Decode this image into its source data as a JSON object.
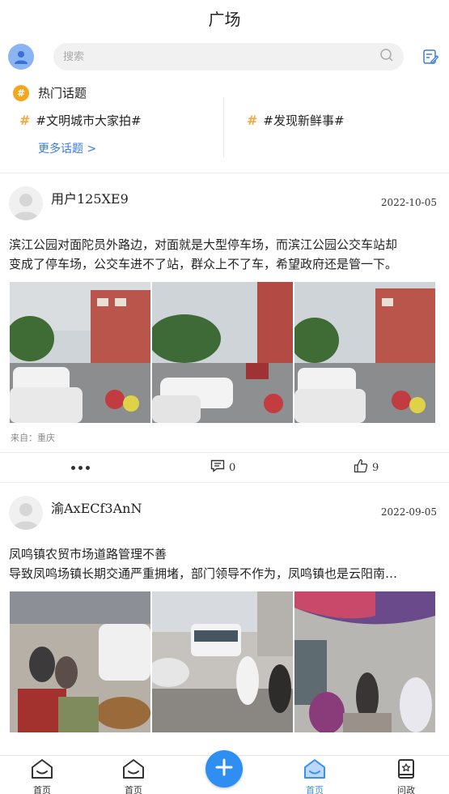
{
  "header": {
    "title": "广场"
  },
  "search": {
    "placeholder": "搜索"
  },
  "topics": {
    "heading": "热门话题",
    "items": [
      "#文明城市大家拍#",
      "#发现新鲜事#"
    ],
    "more_label": "更多话题 >"
  },
  "posts": [
    {
      "username": "用户125XE9",
      "date": "2022-10-05",
      "lines": [
        "滨江公园对面陀员外路边，对面就是大型停车场，而滨江公园公交车站却",
        "变成了停车场，公交车进不了站，群众上不了车，希望政府还是管一下。"
      ],
      "from": "来自：重庆",
      "comment_count": "0",
      "like_count": "9"
    },
    {
      "username": "渝AxECf3AnN",
      "date": "2022-09-05",
      "lines": [
        "凤鸣镇农贸市场道路管理不善",
        "导致凤鸣场镇长期交通严重拥堵，部门领导不作为，凤鸣镇也是云阳南…"
      ]
    }
  ],
  "tabbar": {
    "tabs": [
      "首页",
      "首页",
      "首页",
      "问政"
    ],
    "active_index": 2
  },
  "colors": {
    "accent": "#2f8ef2",
    "topic_hash": "#f2a93b",
    "link": "#3a7be0"
  },
  "icons": [
    "user-avatar-icon",
    "search-icon",
    "edit-icon",
    "hash-icon",
    "more-dots-icon",
    "comment-icon",
    "like-icon",
    "home-icon",
    "plus-icon",
    "book-icon"
  ]
}
